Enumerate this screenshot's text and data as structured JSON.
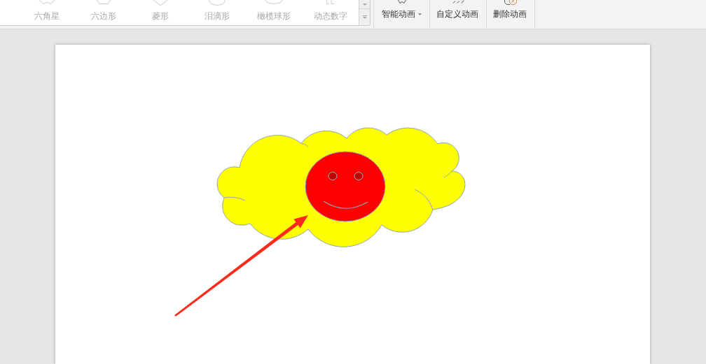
{
  "animation_gallery": {
    "disabled": true,
    "items": [
      {
        "label": "六角星"
      },
      {
        "label": "六边形"
      },
      {
        "label": "菱形"
      },
      {
        "label": "泪滴形"
      },
      {
        "label": "橄榄球形"
      },
      {
        "label": "动态数字"
      }
    ]
  },
  "animation_buttons": [
    {
      "label": "智能动画",
      "dropdown": true
    },
    {
      "label": "自定义动画",
      "dropdown": false
    },
    {
      "label": "删除动画",
      "dropdown": false
    }
  ],
  "slide": {
    "shapes": [
      {
        "kind": "cloud"
      },
      {
        "kind": "smiley"
      },
      {
        "kind": "arrow"
      }
    ]
  }
}
